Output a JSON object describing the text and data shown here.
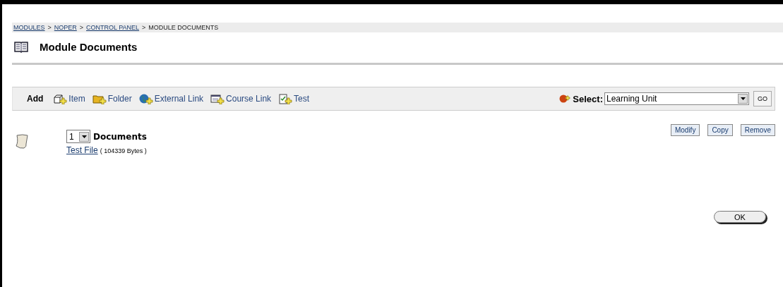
{
  "breadcrumb": [
    {
      "label": "MODULES",
      "link": true
    },
    {
      "separator": ">",
      "label": "NOPER",
      "link": true
    },
    {
      "separator": ">",
      "label": "CONTROL PANEL",
      "link": true
    },
    {
      "separator": ">",
      "label": "MODULE DOCUMENTS",
      "link": false
    }
  ],
  "title": "Module Documents",
  "toolbar": {
    "add_label": "Add",
    "items": [
      {
        "kind": "item",
        "label": "Item"
      },
      {
        "kind": "folder",
        "label": "Folder"
      },
      {
        "kind": "globe",
        "label": "External Link"
      },
      {
        "kind": "course",
        "label": "Course Link"
      },
      {
        "kind": "test",
        "label": "Test"
      }
    ],
    "select_label": "Select:",
    "select_value": "Learning Unit",
    "go": "GO"
  },
  "entry": {
    "order": "1",
    "heading": "Documents",
    "file_link": "Test File",
    "file_size": "( 104339 Bytes )",
    "actions": [
      "Modify",
      "Copy",
      "Remove"
    ]
  },
  "ok": "OK"
}
